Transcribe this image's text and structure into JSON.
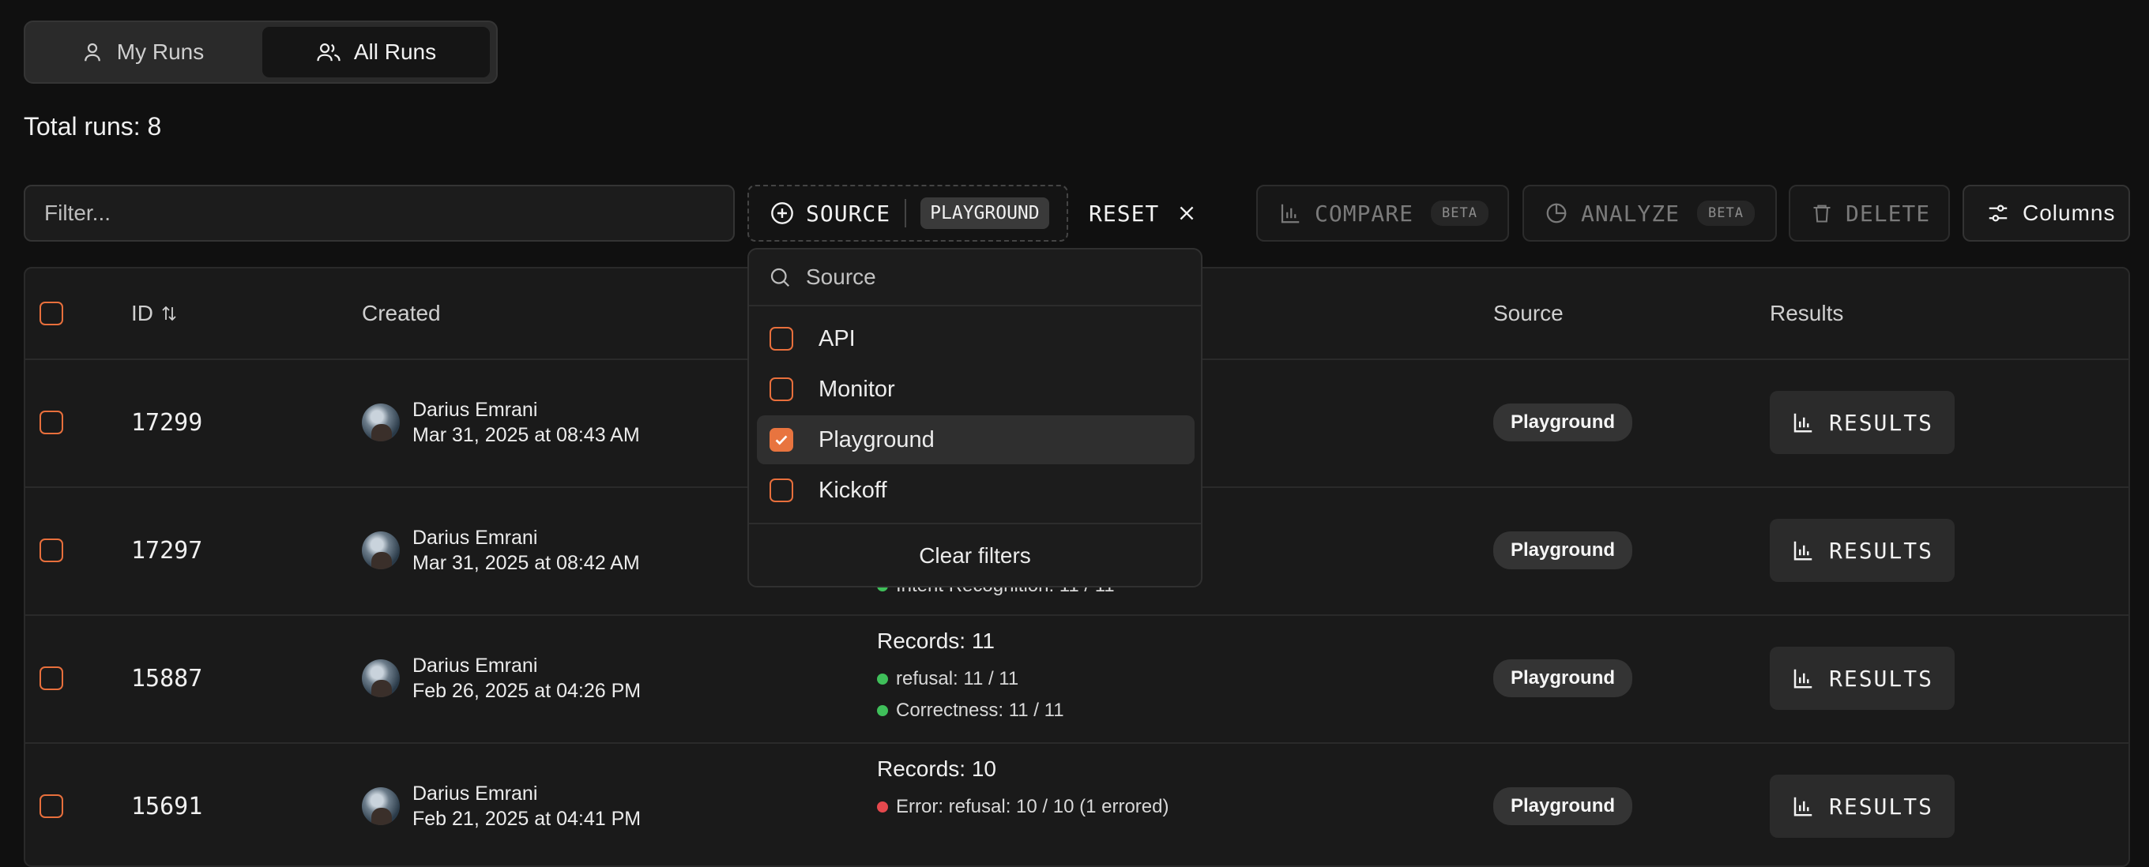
{
  "view_toggle": {
    "my_runs": "My Runs",
    "all_runs": "All Runs"
  },
  "total_runs": "Total runs: 8",
  "toolbar": {
    "filter_placeholder": "Filter...",
    "source_label": "SOURCE",
    "source_chip": "PLAYGROUND",
    "reset_label": "RESET",
    "compare_label": "COMPARE",
    "analyze_label": "ANALYZE",
    "beta_label": "BETA",
    "delete_label": "DELETE",
    "columns_label": "Columns"
  },
  "table": {
    "headers": {
      "id": "ID",
      "created": "Created",
      "source": "Source",
      "results": "Results"
    },
    "rows": [
      {
        "id": "17299",
        "creator": "Darius Emrani",
        "date": "Mar 31, 2025 at 08:43 AM",
        "source": "Playground",
        "results_label": "RESULTS"
      },
      {
        "id": "17297",
        "creator": "Darius Emrani",
        "date": "Mar 31, 2025 at 08:42 AM",
        "partial_metric": "Intent Recognition: 11 / 11",
        "source": "Playground",
        "results_label": "RESULTS"
      },
      {
        "id": "15887",
        "creator": "Darius Emrani",
        "date": "Feb 26, 2025 at 04:26 PM",
        "records": "Records: 11",
        "metrics": [
          "refusal: 11 / 11",
          "Correctness: 11 / 11"
        ],
        "source": "Playground",
        "results_label": "RESULTS"
      },
      {
        "id": "15691",
        "creator": "Darius Emrani",
        "date": "Feb 21, 2025 at 04:41 PM",
        "records": "Records: 10",
        "metrics": [
          "Error: refusal: 10 / 10 (1 errored)"
        ],
        "source": "Playground",
        "results_label": "RESULTS"
      }
    ]
  },
  "source_dropdown": {
    "search_placeholder": "Source",
    "options": [
      {
        "label": "API",
        "checked": false
      },
      {
        "label": "Monitor",
        "checked": false
      },
      {
        "label": "Playground",
        "checked": true
      },
      {
        "label": "Kickoff",
        "checked": false
      }
    ],
    "clear_label": "Clear filters"
  },
  "colors": {
    "accent": "#e8743f",
    "success": "#3fbf5a",
    "error": "#e5484d",
    "background": "#101010"
  }
}
